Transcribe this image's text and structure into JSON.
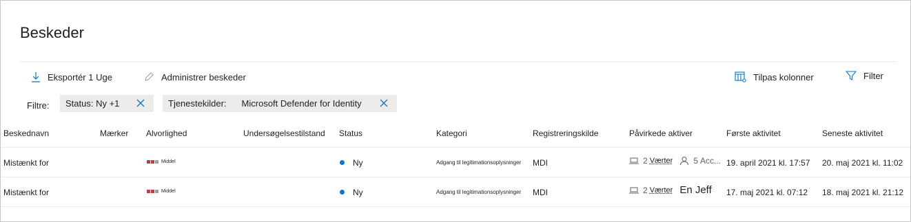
{
  "page": {
    "title": "Beskeder"
  },
  "commands": {
    "export": "Eksportér 1 Uge",
    "manage": "Administrer beskeder",
    "columns": "Tilpas kolonner",
    "filter": "Filter"
  },
  "filters": {
    "label": "Filtre:",
    "chips": [
      {
        "key": "Status: Ny +1",
        "value": ""
      },
      {
        "key": "Tjenestekilder:",
        "value": "Microsoft Defender for Identity"
      }
    ]
  },
  "table": {
    "columns": [
      "Beskednavn",
      "Mærker",
      "Alvorlighed",
      "Undersøgelsestilstand",
      "Status",
      "Kategori",
      "Registreringskilde",
      "Påvirkede aktiver",
      "Første aktivitet",
      "Seneste aktivitet"
    ],
    "rows": [
      {
        "name": "Mistænkt for",
        "severity": "Middel",
        "status": "Ny",
        "category": "Adgang til legitimationsoplysninger",
        "source": "MDI",
        "hosts_count": "2",
        "hosts_label": "Værter",
        "accounts_count": "5",
        "accounts_label": "Acc...",
        "first": "19. april 2021 kl. 17:57",
        "last": "20. maj 2021 kl. 11:02"
      },
      {
        "name": "Mistænkt for",
        "severity": "Middel",
        "status": "Ny",
        "category": "Adgang til legitimationsoplysninger",
        "source": "MDI",
        "hosts_count": "2",
        "hosts_label": "Værter",
        "user": "En Jeff",
        "first": "17. maj 2021 kl. 07:12",
        "last": "18. maj 2021 kl. 21:12"
      }
    ]
  },
  "colors": {
    "accent": "#0078d4",
    "severity_high": "#d13438",
    "severity_off": "#a19f9d"
  }
}
